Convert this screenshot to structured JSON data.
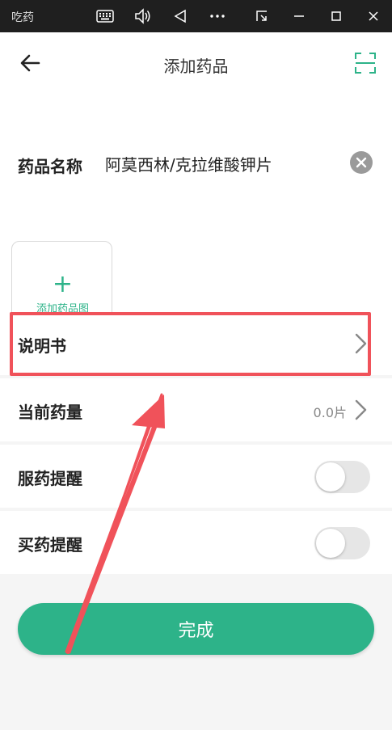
{
  "window": {
    "app_title": "吃药",
    "icons": [
      "keyboard-icon",
      "volume-icon",
      "back-triangle-icon",
      "more-icon",
      "screen-capture-icon",
      "minimize-icon",
      "maximize-icon",
      "close-icon"
    ]
  },
  "header": {
    "title": "添加药品",
    "back_icon": "arrow-left-icon",
    "scan_icon": "scan-icon"
  },
  "drug": {
    "name_label": "药品名称",
    "name_value": "阿莫西林/克拉维酸钾片",
    "add_image_plus": "+",
    "add_image_label": "添加药品图"
  },
  "rows": {
    "instructions_label": "说明书",
    "dosage_label": "当前药量",
    "dosage_value": "0.0片",
    "take_reminder_label": "服药提醒",
    "take_reminder_on": false,
    "buy_reminder_label": "买药提醒",
    "buy_reminder_on": false
  },
  "actions": {
    "done_label": "完成"
  },
  "colors": {
    "accent": "#2db389",
    "annotation": "#f0525a",
    "titlebar": "#1f1f1f"
  }
}
